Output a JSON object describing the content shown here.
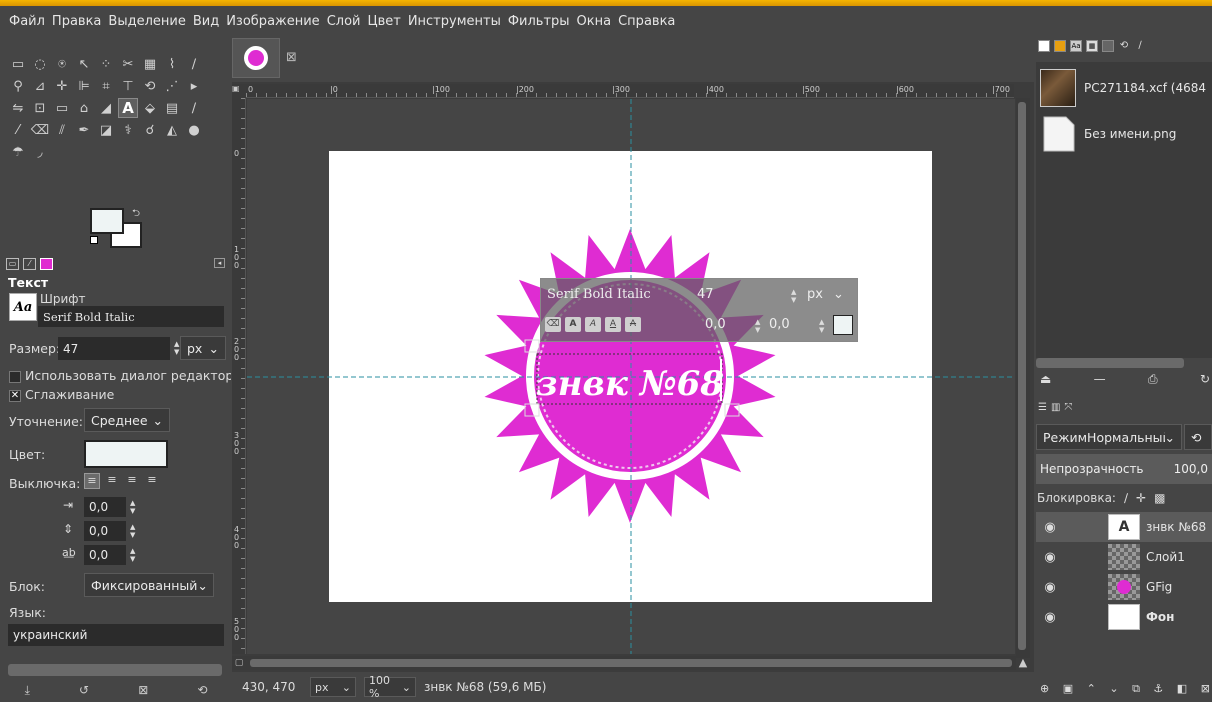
{
  "menu": [
    "Файл",
    "Правка",
    "Выделение",
    "Вид",
    "Изображение",
    "Слой",
    "Цвет",
    "Инструменты",
    "Фильтры",
    "Окна",
    "Справка"
  ],
  "tool_options": {
    "title": "Текст",
    "font_label": "Шрифт",
    "font_value": "Serif Bold Italic",
    "font_preview": "Aa",
    "size_label": "Размер:",
    "size_value": "47",
    "size_unit": "px",
    "use_editor_label": "Использовать диалог редактора",
    "antialias_label": "Сглаживание",
    "hinting_label": "Уточнение:",
    "hinting_value": "Среднее",
    "color_label": "Цвет:",
    "color_value": "#eef4f4",
    "justify_label": "Выключка:",
    "indent_value": "0,0",
    "line_spacing_value": "0,0",
    "letter_spacing_value": "0,0",
    "box_label": "Блок:",
    "box_value": "Фиксированный",
    "language_label": "Язык:",
    "language_value": "украинский"
  },
  "ruler": {
    "h_labels": [
      "0",
      "|0",
      "|100",
      "|200",
      "|300",
      "|400",
      "|500",
      "|600",
      "|700"
    ],
    "v_labels": [
      "0",
      "1 0 0",
      "2 0 0",
      "3 0 0",
      "4 0 0",
      "5 0 0"
    ]
  },
  "canvas": {
    "text_on_image": "знвк №68",
    "badge_color": "#df2cd2",
    "overlay_font": "Serif Bold Italic",
    "overlay_size": "47",
    "overlay_unit": "px",
    "overlay_baseline": "0,0",
    "overlay_kerning": "0,0"
  },
  "status": {
    "coords": "430, 470",
    "unit": "px",
    "zoom": "100 %",
    "info": "знвк №68 (59,6 МБ)"
  },
  "images": [
    {
      "name": "PC271184.xcf (4684"
    },
    {
      "name": "Без имени.png"
    }
  ],
  "layers_panel": {
    "mode_label": "Режим",
    "mode_value": "Нормальный",
    "opacity_label": "Непрозрачность",
    "opacity_value": "100,0",
    "lock_label": "Блокировка:",
    "layers": [
      {
        "name": "знвк №68",
        "kind": "text"
      },
      {
        "name": "Слой1",
        "kind": "transparent"
      },
      {
        "name": "GFig",
        "kind": "gfig"
      },
      {
        "name": "Фон",
        "kind": "white"
      }
    ]
  }
}
